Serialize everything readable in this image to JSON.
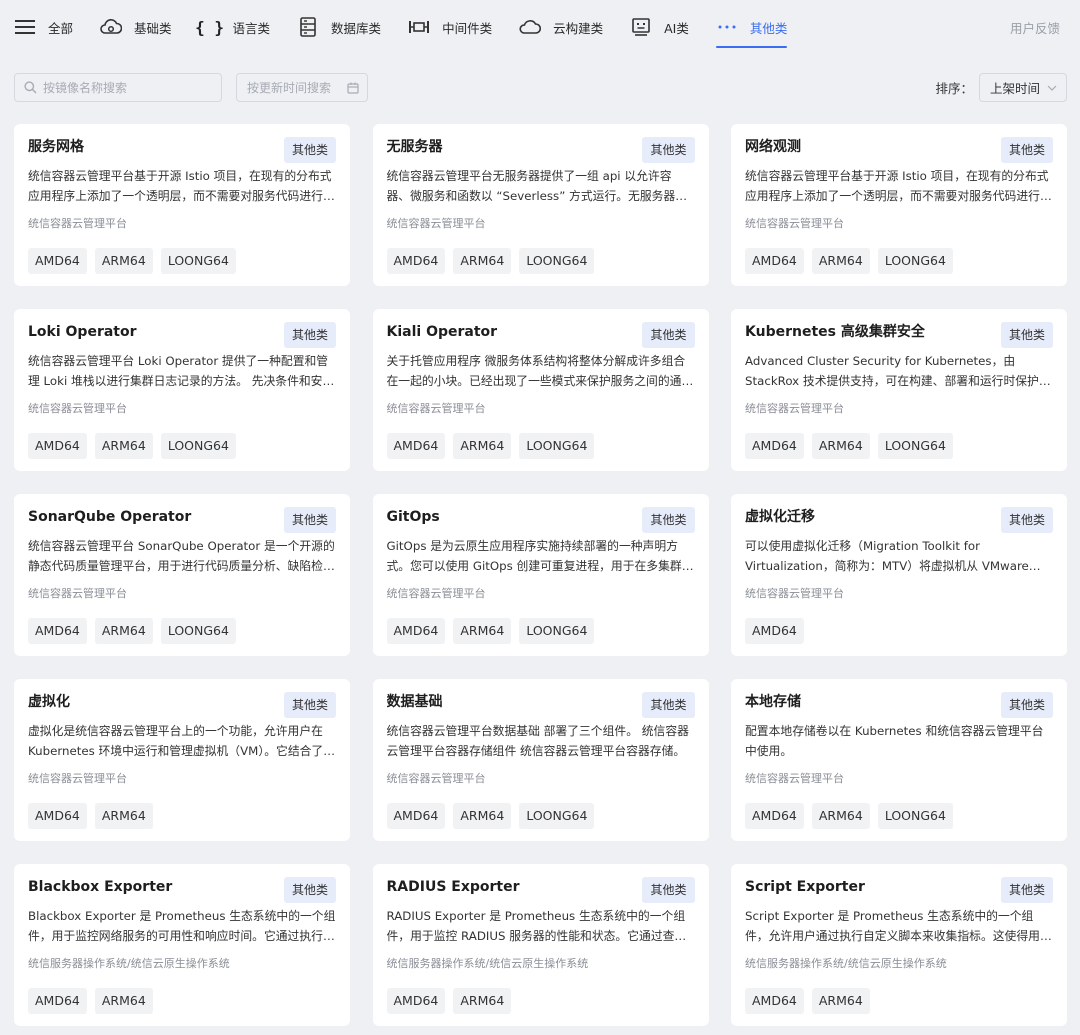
{
  "nav": {
    "items": [
      {
        "label": "全部",
        "icon": "menu-icon"
      },
      {
        "label": "基础类",
        "icon": "cloud-gear-icon"
      },
      {
        "label": "语言类",
        "icon": "braces-icon"
      },
      {
        "label": "数据库类",
        "icon": "database-icon"
      },
      {
        "label": "中间件类",
        "icon": "middleware-icon"
      },
      {
        "label": "云构建类",
        "icon": "cloud-icon"
      },
      {
        "label": "AI类",
        "icon": "robot-icon"
      },
      {
        "label": "其他类",
        "icon": "more-dots-icon"
      }
    ],
    "active_index": 7,
    "active_color": "#3b6df2",
    "feedback": "用户反馈"
  },
  "toolbar": {
    "search_placeholder": "按镜像名称搜索",
    "date_placeholder": "按更新时间搜索",
    "sort_label": "排序：",
    "sort_value": "上架时间"
  },
  "cards": [
    {
      "title": "服务网格",
      "badge": "其他类",
      "desc": "统信容器云管理平台基于开源 Istio 项目，在现有的分布式应用程序上添加了一个透明层，而不需要对服务代码进行任何更改。",
      "vendor": "统信容器云管理平台",
      "tags": [
        "AMD64",
        "ARM64",
        "LOONG64"
      ]
    },
    {
      "title": "无服务器",
      "badge": "其他类",
      "desc": "统信容器云管理平台无服务器提供了一组 api 以允许容器、微服务和函数以 “Severless” 方式运行。无服务器应用程序可以按需扩展。",
      "vendor": "统信容器云管理平台",
      "tags": [
        "AMD64",
        "ARM64",
        "LOONG64"
      ]
    },
    {
      "title": "网络观测",
      "badge": "其他类",
      "desc": "统信容器云管理平台基于开源 Istio 项目，在现有的分布式应用程序上添加了一个透明层，而不需要对服务代码进行任何更改。",
      "vendor": "统信容器云管理平台",
      "tags": [
        "AMD64",
        "ARM64",
        "LOONG64"
      ]
    },
    {
      "title": "Loki Operator",
      "badge": "其他类",
      "desc": "统信容器云管理平台 Loki Operator 提供了一种配置和管理 Loki 堆栈以进行集群日志记录的方法。 先决条件和安装说明。",
      "vendor": "统信容器云管理平台",
      "tags": [
        "AMD64",
        "ARM64",
        "LOONG64"
      ]
    },
    {
      "title": "Kiali Operator",
      "badge": "其他类",
      "desc": "关于托管应用程序 微服务体系结构将整体分解成许多组合在一起的小块。已经出现了一些模式来保护服务之间的通信。",
      "vendor": "统信容器云管理平台",
      "tags": [
        "AMD64",
        "ARM64",
        "LOONG64"
      ]
    },
    {
      "title": "Kubernetes 高级集群安全",
      "badge": "其他类",
      "desc": "Advanced Cluster Security for Kubernetes，由 StackRox 技术提供支持，可在构建、部署和运行时保护您的应用。",
      "vendor": "统信容器云管理平台",
      "tags": [
        "AMD64",
        "ARM64",
        "LOONG64"
      ]
    },
    {
      "title": "SonarQube Operator",
      "badge": "其他类",
      "desc": "统信容器云管理平台 SonarQube Operator 是一个开源的静态代码质量管理平台，用于进行代码质量分析、缺陷检测和安全扫描。",
      "vendor": "统信容器云管理平台",
      "tags": [
        "AMD64",
        "ARM64",
        "LOONG64"
      ]
    },
    {
      "title": "GitOps",
      "badge": "其他类",
      "desc": "GitOps 是为云原生应用程序实施持续部署的一种声明方式。您可以使用 GitOps 创建可重复进程，用于在多集群环境中管理应用。",
      "vendor": "统信容器云管理平台",
      "tags": [
        "AMD64",
        "ARM64",
        "LOONG64"
      ]
    },
    {
      "title": "虚拟化迁移",
      "badge": "其他类",
      "desc": "可以使用虚拟化迁移（Migration Toolkit for Virtualization，简称为：MTV）将虚拟机从 VMware vSphere 迁移。",
      "vendor": "统信容器云管理平台",
      "tags": [
        "AMD64"
      ]
    },
    {
      "title": "虚拟化",
      "badge": "其他类",
      "desc": "虚拟化是统信容器云管理平台上的一个功能，允许用户在 Kubernetes 环境中运行和管理虚拟机（VM）。它结合了容器与虚拟机。",
      "vendor": "统信容器云管理平台",
      "tags": [
        "AMD64",
        "ARM64"
      ]
    },
    {
      "title": "数据基础",
      "badge": "其他类",
      "desc": "统信容器云管理平台数据基础 部署了三个组件。 统信容器云管理平台容器存储组件 统信容器云管理平台容器存储。",
      "vendor": "统信容器云管理平台",
      "tags": [
        "AMD64",
        "ARM64",
        "LOONG64"
      ]
    },
    {
      "title": "本地存储",
      "badge": "其他类",
      "desc": "配置本地存储卷以在 Kubernetes 和统信容器云管理平台中使用。",
      "vendor": "统信容器云管理平台",
      "tags": [
        "AMD64",
        "ARM64",
        "LOONG64"
      ]
    },
    {
      "title": "Blackbox Exporter",
      "badge": "其他类",
      "desc": "Blackbox Exporter 是 Prometheus 生态系统中的一个组件，用于监控网络服务的可用性和响应时间。它通过执行探测来工作。",
      "vendor": "统信服务器操作系统/统信云原生操作系统",
      "tags": [
        "AMD64",
        "ARM64"
      ]
    },
    {
      "title": "RADIUS Exporter",
      "badge": "其他类",
      "desc": "RADIUS Exporter 是 Prometheus 生态系统中的一个组件，用于监控 RADIUS 服务器的性能和状态。它通过查询服务器来工作。",
      "vendor": "统信服务器操作系统/统信云原生操作系统",
      "tags": [
        "AMD64",
        "ARM64"
      ]
    },
    {
      "title": "Script Exporter",
      "badge": "其他类",
      "desc": "Script Exporter 是 Prometheus 生态系统中的一个组件，允许用户通过执行自定义脚本来收集指标。这使得用户可以灵活监控。",
      "vendor": "统信服务器操作系统/统信云原生操作系统",
      "tags": [
        "AMD64",
        "ARM64"
      ]
    }
  ]
}
